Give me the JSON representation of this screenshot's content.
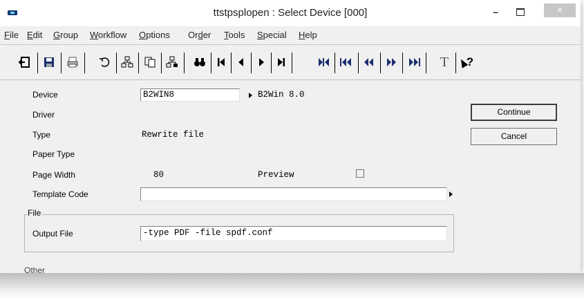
{
  "window": {
    "title": "ttstpsplopen : Select Device [000]",
    "min_symbol": "–",
    "close_symbol": "×"
  },
  "menu": [
    {
      "accel": "F",
      "rest": "ile"
    },
    {
      "accel": "E",
      "rest": "dit"
    },
    {
      "accel": "G",
      "rest": "roup"
    },
    {
      "accel": "W",
      "rest": "orkflow"
    },
    {
      "accel": "O",
      "rest": "ptions"
    },
    {
      "pre": "Or",
      "accel": "d",
      "rest": "er"
    },
    {
      "accel": "T",
      "rest": "ools"
    },
    {
      "accel": "S",
      "rest": "pecial"
    },
    {
      "accel": "H",
      "rest": "elp"
    }
  ],
  "toolbar": {
    "text_tool_glyph": "T",
    "help_glyph": "?"
  },
  "form": {
    "device_label": "Device",
    "device_value": "B2WIN8",
    "device_description": "B2Win 8.0",
    "driver_label": "Driver",
    "type_label": "Type",
    "type_value": "Rewrite file",
    "paper_type_label": "Paper Type",
    "page_width_label": "Page Width",
    "page_width_value": "80",
    "preview_label": "Preview",
    "template_code_label": "Template Code",
    "template_code_value": "",
    "file_group_label": "File",
    "output_file_label": "Output File",
    "output_file_value": "-type PDF -file spdf.conf",
    "cutoff_label": "Other"
  },
  "buttons": {
    "continue_label": "Continue",
    "cancel_label": "Cancel"
  }
}
